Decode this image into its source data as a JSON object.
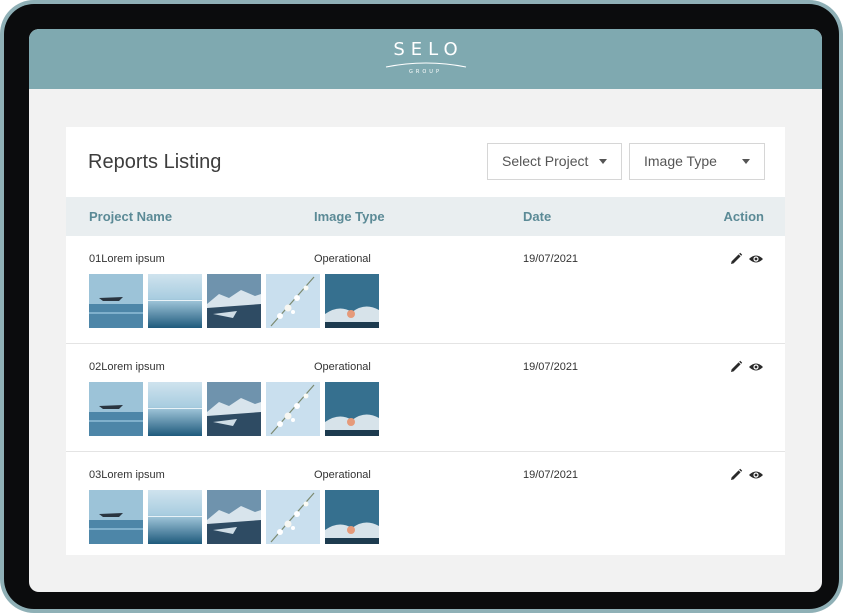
{
  "header": {
    "logo_text": "SELO",
    "logo_subtext": "GROUP"
  },
  "reports": {
    "title": "Reports Listing",
    "filters": {
      "project": {
        "selected": "Select Project"
      },
      "image_type": {
        "selected": "Image Type"
      }
    },
    "columns": {
      "name": "Project Name",
      "type": "Image Type",
      "date": "Date",
      "action": "Action"
    },
    "rows": [
      {
        "name": "01Lorem ipsum",
        "type": "Operational",
        "date": "19/07/2021"
      },
      {
        "name": "02Lorem ipsum",
        "type": "Operational",
        "date": "19/07/2021"
      },
      {
        "name": "03Lorem ipsum",
        "type": "Operational",
        "date": "19/07/2021"
      }
    ],
    "row_actions": [
      "pencil-icon",
      "eye-icon"
    ],
    "thumbnails": [
      "boat-on-calm-water",
      "misty-horizon-sea",
      "snowy-coastline",
      "white-blossom-branch",
      "waves-under-sky"
    ]
  },
  "colors": {
    "frame": "#8fb0b6",
    "header_bar": "#7fa9b0",
    "column_header_text": "#5b8a96"
  }
}
